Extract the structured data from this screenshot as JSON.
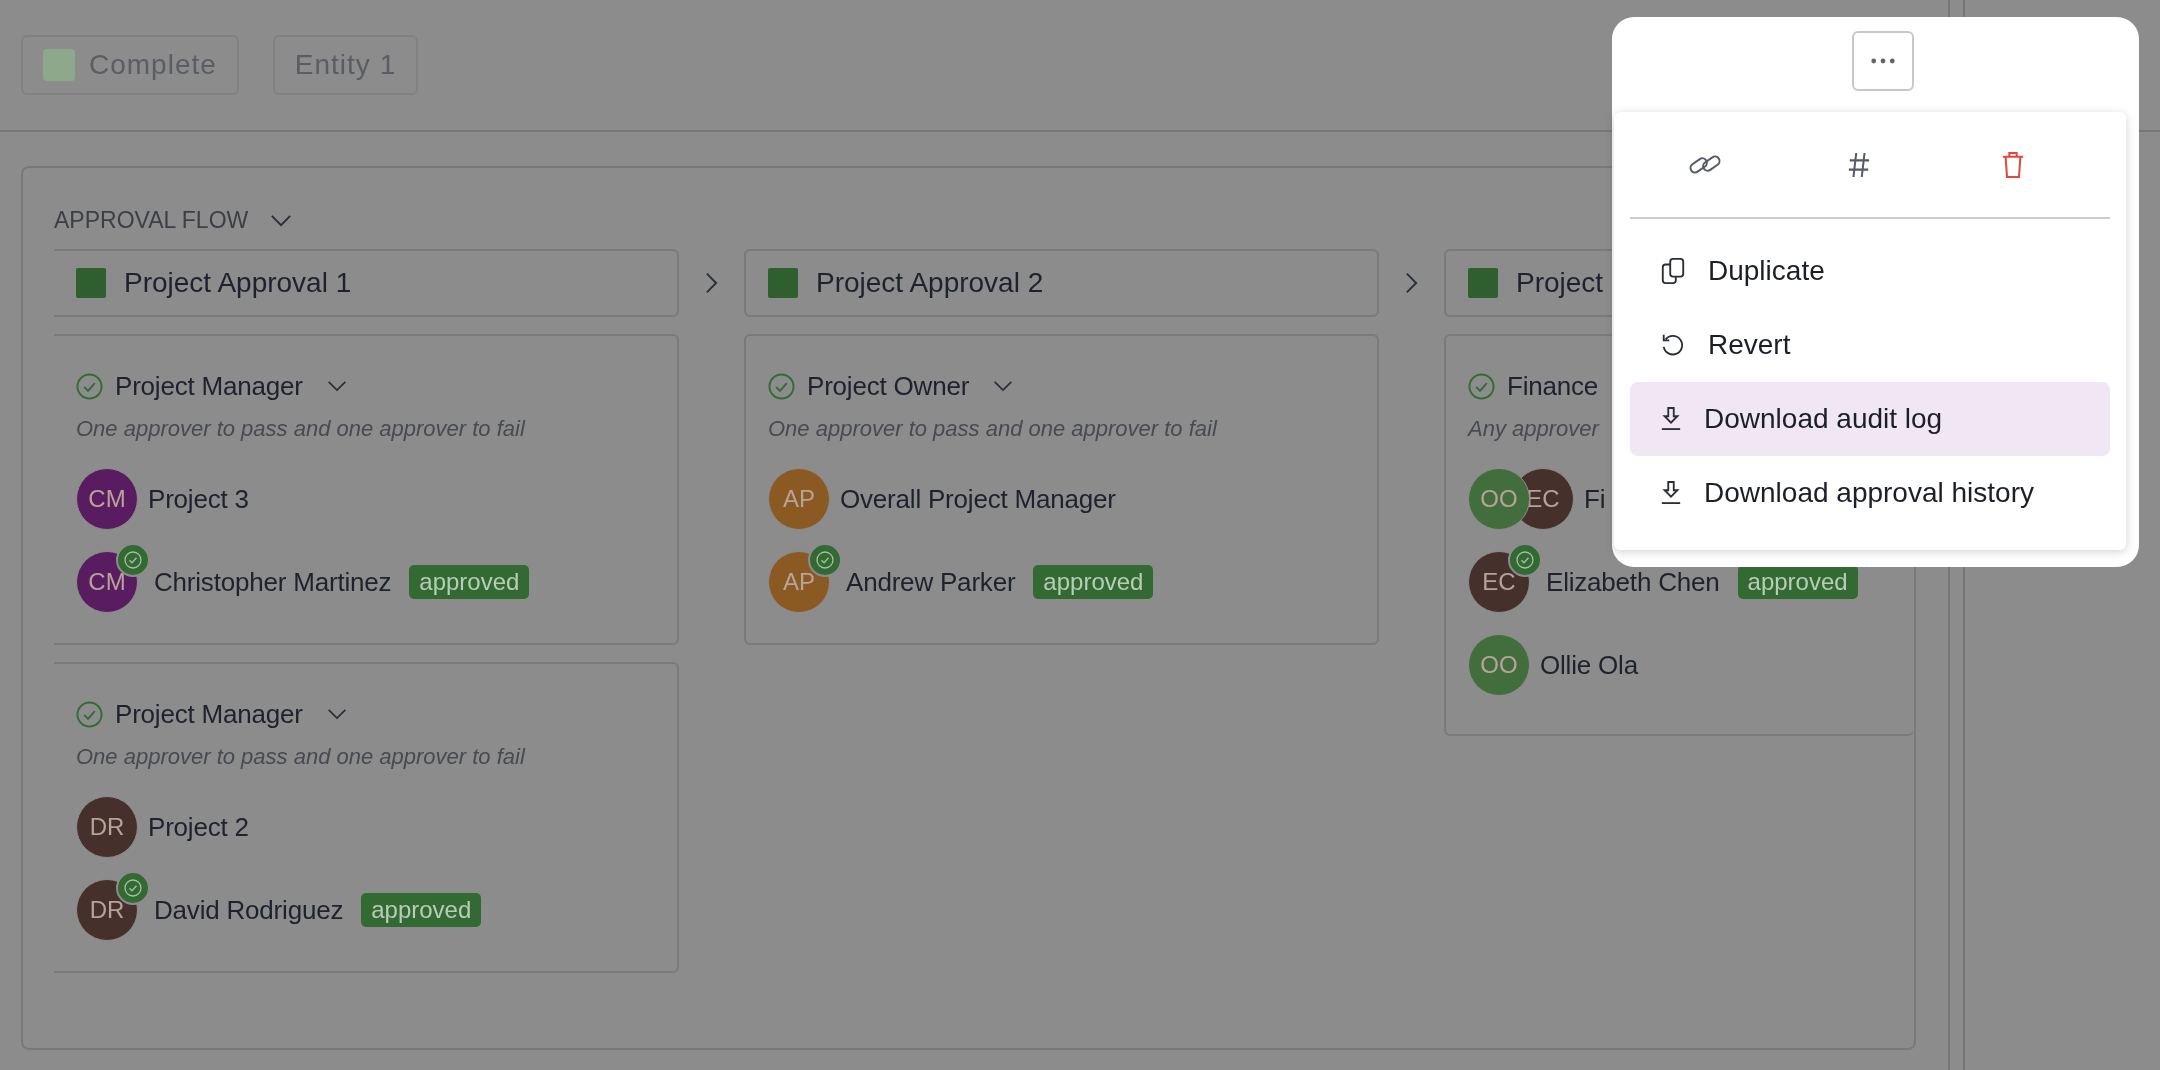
{
  "toolbar": {
    "status_chip": {
      "label": "Complete"
    },
    "entity_chip": {
      "label": "Entity 1"
    }
  },
  "approval_flow": {
    "title": "APPROVAL FLOW",
    "stages": [
      {
        "title": "Project Approval 1",
        "groups": [
          {
            "role": "Project Manager",
            "collapsible": true,
            "rule": "One approver to pass and one approver to fail",
            "members": [
              {
                "avatars": [
                  {
                    "initials": "CM",
                    "color": "#5a1c60"
                  }
                ],
                "name": "Project 3",
                "approved": false
              },
              {
                "avatars": [
                  {
                    "initials": "CM",
                    "color": "#5a1c60"
                  }
                ],
                "name": "Christopher Martinez",
                "approved": true,
                "status": "approved"
              }
            ]
          },
          {
            "role": "Project Manager",
            "collapsible": true,
            "rule": "One approver to pass and one approver to fail",
            "members": [
              {
                "avatars": [
                  {
                    "initials": "DR",
                    "color": "#46302b"
                  }
                ],
                "name": "Project 2",
                "approved": false
              },
              {
                "avatars": [
                  {
                    "initials": "DR",
                    "color": "#46302b"
                  }
                ],
                "name": "David Rodriguez",
                "approved": true,
                "status": "approved"
              }
            ]
          }
        ]
      },
      {
        "title": "Project Approval 2",
        "groups": [
          {
            "role": "Project Owner",
            "collapsible": true,
            "rule": "One approver to pass and one approver to fail",
            "members": [
              {
                "avatars": [
                  {
                    "initials": "AP",
                    "color": "#8a5a22"
                  }
                ],
                "name": "Overall Project Manager",
                "approved": false
              },
              {
                "avatars": [
                  {
                    "initials": "AP",
                    "color": "#8a5a22"
                  }
                ],
                "name": "Andrew Parker",
                "approved": true,
                "status": "approved"
              }
            ]
          }
        ]
      },
      {
        "title": "Project",
        "groups": [
          {
            "role": "Finance",
            "collapsible": false,
            "rule": "Any approver",
            "members": [
              {
                "avatars": [
                  {
                    "initials": "OO",
                    "color": "#426d3c"
                  },
                  {
                    "initials": "EC",
                    "color": "#46302b"
                  }
                ],
                "name": "Fi",
                "approved": false
              },
              {
                "avatars": [
                  {
                    "initials": "EC",
                    "color": "#46302b"
                  }
                ],
                "name": "Elizabeth Chen",
                "approved": true,
                "status": "approved"
              },
              {
                "avatars": [
                  {
                    "initials": "OO",
                    "color": "#426d3c"
                  }
                ],
                "name": "Ollie Ola",
                "approved": false
              }
            ]
          }
        ]
      }
    ]
  },
  "menu": {
    "items": [
      {
        "kind": "duplicate",
        "label": "Duplicate",
        "selected": false
      },
      {
        "kind": "revert",
        "label": "Revert",
        "selected": false
      },
      {
        "kind": "download",
        "label": "Download audit log",
        "selected": true
      },
      {
        "kind": "download",
        "label": "Download approval history",
        "selected": false
      }
    ]
  }
}
